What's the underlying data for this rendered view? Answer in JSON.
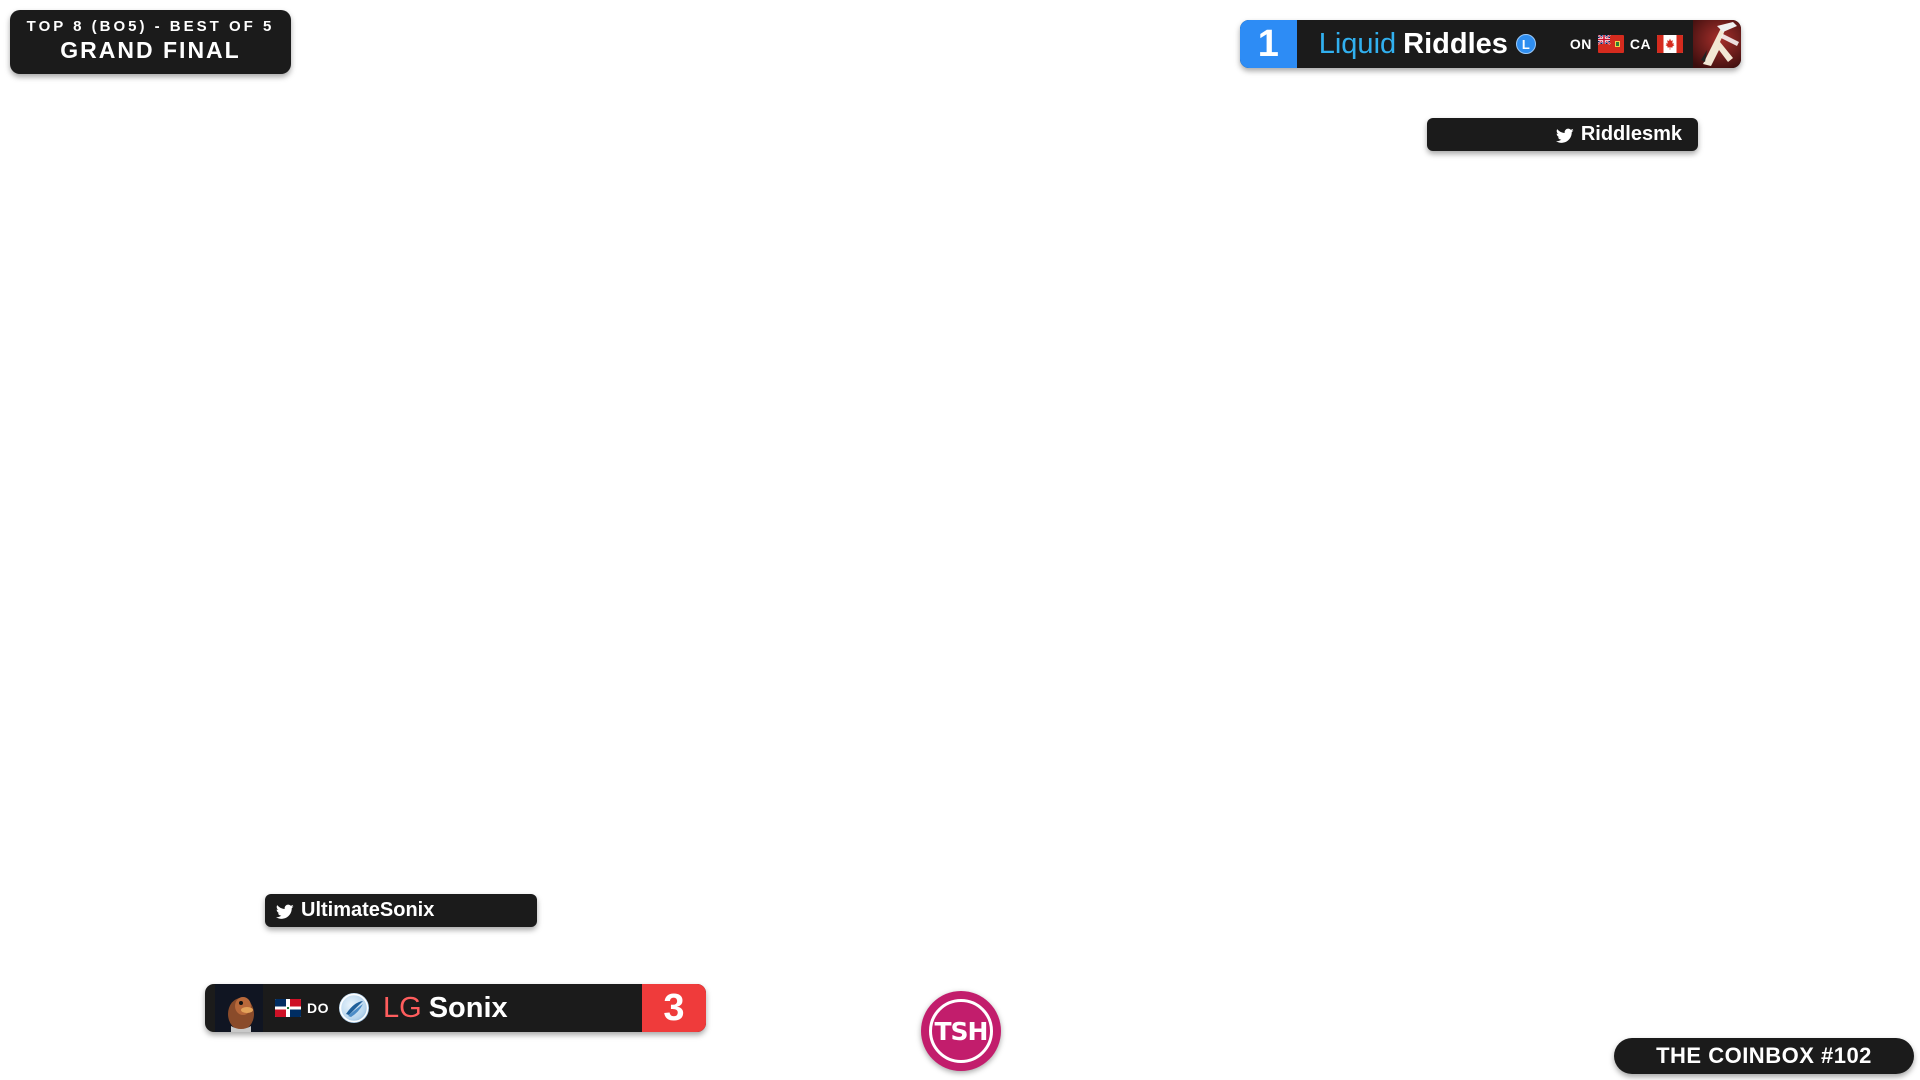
{
  "phase_box": {
    "phase": "TOP 8 (BO5) - BEST OF 5",
    "match": "GRAND FINAL"
  },
  "player1": {
    "score": "1",
    "sponsor": "Liquid",
    "gamertag": "Riddles",
    "pronoun_badge": "L",
    "state_code": "ON",
    "country_code": "CA",
    "twitter": "Riddlesmk",
    "score_color": "#2d8cf5",
    "sponsor_color": "#31b0ef"
  },
  "player2": {
    "score": "3",
    "sponsor": "LG",
    "gamertag": "Sonix",
    "country_code": "DO",
    "twitter": "UltimateSonix",
    "score_color": "#ef3b3b",
    "sponsor_color": "#ff5d5d"
  },
  "event": {
    "name": "THE COINBOX #102"
  },
  "logo": {
    "text": "TSH",
    "color": "#c21d6c"
  },
  "icons": {
    "twitter": "twitter-bird-icon",
    "flag_ontario": "ontario-flag-icon",
    "flag_canada": "canada-flag-icon",
    "flag_dominican_republic": "dominican-republic-flag-icon"
  }
}
